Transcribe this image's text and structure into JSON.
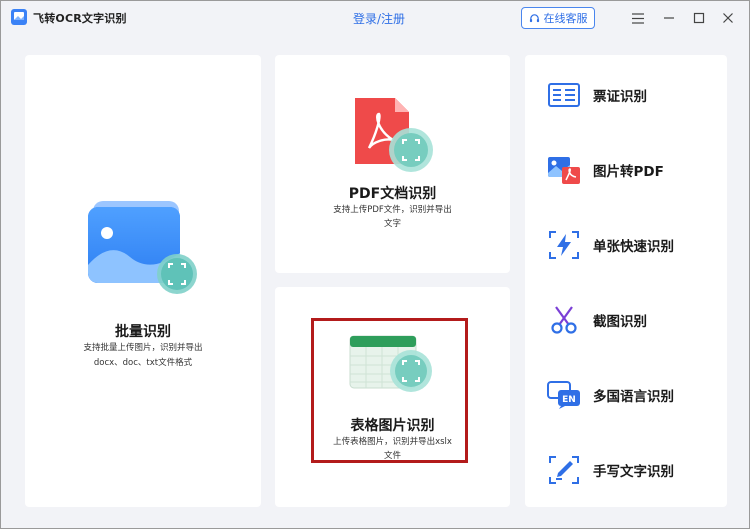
{
  "titlebar": {
    "app_title": "飞转OCR文字识别",
    "login": "登录/注册",
    "service": "在线客服"
  },
  "cards": {
    "batch": {
      "title": "批量识别",
      "desc_line1": "支持批量上传图片，识别并导出",
      "desc_line2": "docx、doc、txt文件格式"
    },
    "pdf": {
      "title": "PDF文档识别",
      "desc_line1": "支持上传PDF文件，识别并导出",
      "desc_line2": "文字"
    },
    "table": {
      "title": "表格图片识别",
      "desc_line1": "上传表格图片，识别并导出xslx",
      "desc_line2": "文件"
    }
  },
  "sidebar": {
    "items": [
      {
        "label": "票证识别",
        "icon": "id-card-icon"
      },
      {
        "label": "图片转PDF",
        "icon": "image-to-pdf-icon"
      },
      {
        "label": "单张快速识别",
        "icon": "lightning-scan-icon"
      },
      {
        "label": "截图识别",
        "icon": "scissors-icon"
      },
      {
        "label": "多国语言识别",
        "icon": "language-en-icon"
      },
      {
        "label": "手写文字识别",
        "icon": "pen-icon"
      }
    ]
  },
  "colors": {
    "brand_blue": "#2f6fe6",
    "pdf_red": "#ef4a4a",
    "table_green": "#2e9e5b",
    "highlight_red": "#b31b1b"
  }
}
